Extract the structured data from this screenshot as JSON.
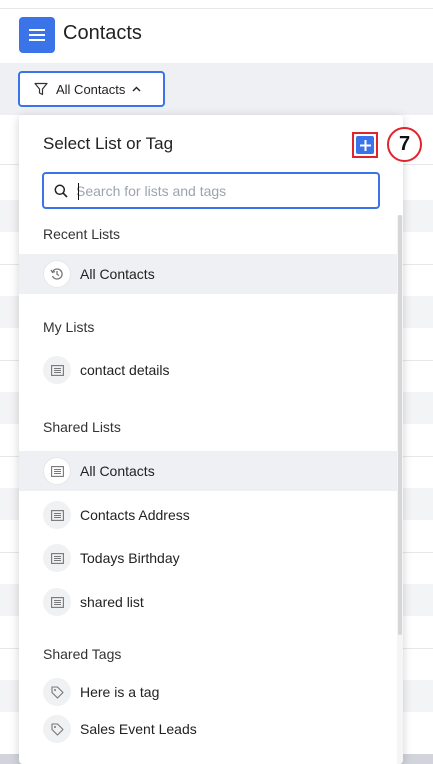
{
  "header": {
    "title": "Contacts"
  },
  "toolbar": {
    "filter_label": "All Contacts"
  },
  "dropdown": {
    "title": "Select List or Tag",
    "search_placeholder": "Search for lists and tags",
    "sections": {
      "recent": {
        "label": "Recent Lists",
        "items": [
          "All Contacts"
        ]
      },
      "my": {
        "label": "My Lists",
        "items": [
          "contact details"
        ]
      },
      "shared": {
        "label": "Shared Lists",
        "items": [
          "All Contacts",
          "Contacts Address",
          "Todays Birthday",
          "shared list"
        ]
      },
      "tags": {
        "label": "Shared Tags",
        "items": [
          "Here is a tag",
          "Sales Event Leads"
        ]
      }
    }
  },
  "annotation": {
    "step": "7"
  },
  "colors": {
    "accent": "#3b73e8",
    "highlight": "#e0242b",
    "active_row": "#eef0f3"
  },
  "icons": {
    "menu": "hamburger-icon",
    "filter": "filter-icon",
    "chevron": "chevron-up-icon",
    "add": "plus-icon",
    "search": "search-icon",
    "history": "history-icon",
    "list": "list-icon",
    "tag": "tag-icon"
  }
}
